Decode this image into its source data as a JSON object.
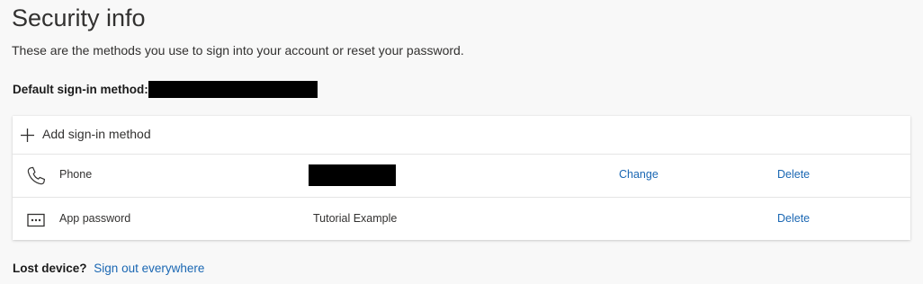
{
  "header": {
    "title": "Security info",
    "subtitle": "These are the methods you use to sign into your account or reset your password."
  },
  "default_method": {
    "label": "Default sign-in method:",
    "value_redacted": true
  },
  "methods": {
    "add_label": "Add sign-in method",
    "add_icon": "plus-icon",
    "rows": [
      {
        "icon": "phone-icon",
        "name": "Phone",
        "detail": "",
        "detail_redacted": true,
        "change_label": "Change",
        "delete_label": "Delete"
      },
      {
        "icon": "app-password-icon",
        "name": "App password",
        "detail": "Tutorial Example",
        "detail_redacted": false,
        "change_label": "",
        "delete_label": "Delete"
      }
    ]
  },
  "footer": {
    "lost_label": "Lost device?",
    "signout_label": "Sign out everywhere"
  },
  "colors": {
    "link": "#1a67b3",
    "background": "#f8f8f8",
    "card": "#ffffff",
    "redaction": "#000000"
  }
}
